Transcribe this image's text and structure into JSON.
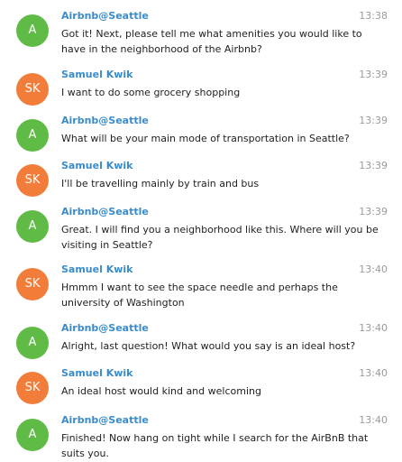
{
  "colors": {
    "bot_avatar": "#5fbb46",
    "user_avatar": "#f27d3b",
    "sender_name": "#3a8bc9",
    "timestamp": "#9a9a9a"
  },
  "messages": [
    {
      "avatar": "A",
      "sender": "Airbnb@Seattle",
      "time": "13:38",
      "text": "Got it! Next, please tell me what amenities you would like to have in the neighborhood of the Airbnb?"
    },
    {
      "avatar": "SK",
      "sender": "Samuel Kwik",
      "time": "13:39",
      "text": "I want to do some grocery shopping"
    },
    {
      "avatar": "A",
      "sender": "Airbnb@Seattle",
      "time": "13:39",
      "text": "What will be your main mode of transportation in Seattle?"
    },
    {
      "avatar": "SK",
      "sender": "Samuel Kwik",
      "time": "13:39",
      "text": "I'll be travelling mainly by train and bus"
    },
    {
      "avatar": "A",
      "sender": "Airbnb@Seattle",
      "time": "13:39",
      "text": "Great. I will find you a neighborhood like this. Where will you be visiting in Seattle?"
    },
    {
      "avatar": "SK",
      "sender": "Samuel Kwik",
      "time": "13:40",
      "text": "Hmmm I want to see the space needle and perhaps the university of Washington"
    },
    {
      "avatar": "A",
      "sender": "Airbnb@Seattle",
      "time": "13:40",
      "text": "Alright, last question! What would you say is an ideal host?"
    },
    {
      "avatar": "SK",
      "sender": "Samuel Kwik",
      "time": "13:40",
      "text": "An ideal host would kind and welcoming"
    },
    {
      "avatar": "A",
      "sender": "Airbnb@Seattle",
      "time": "13:40",
      "text": "Finished! Now hang on tight while I search for the AirBnB that suits you."
    }
  ]
}
